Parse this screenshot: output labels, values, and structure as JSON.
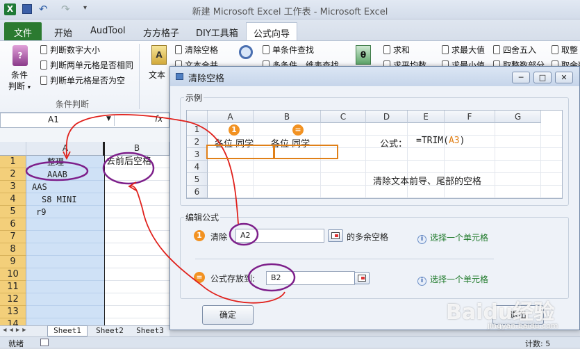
{
  "window": {
    "title": "新建 Microsoft Excel 工作表 - Microsoft Excel",
    "app_icon": "excel-logo"
  },
  "ribbon_tabs": [
    "文件",
    "开始",
    "AudTool",
    "方方格子",
    "DIY工具箱",
    "公式向导"
  ],
  "active_tab_index": 5,
  "ribbon": {
    "big_button_1": {
      "line1": "条件",
      "line2": "判断"
    },
    "cond_items": [
      "判断数字大小",
      "判断两单元格是否相同",
      "判断单元格是否为空"
    ],
    "group_label": "条件判断",
    "big_button_2": "文本",
    "text_items": [
      "清除空格",
      "文本合并"
    ],
    "lookup_items": [
      "单条件查找",
      "多条件、维表查找"
    ],
    "math_items": [
      "求和",
      "求平均数"
    ],
    "stat_items": [
      "求最大值",
      "求最小值"
    ],
    "round_items": [
      "四舍五入",
      "取整数部分"
    ],
    "cut_items": [
      "取整",
      "取余数"
    ]
  },
  "name_box": "A1",
  "formula_fx": "fx",
  "sheet": {
    "columns": [
      "A",
      "B"
    ],
    "rows": [
      "1",
      "2",
      "3",
      "4",
      "5",
      "6",
      "7",
      "8",
      "9",
      "10",
      "11",
      "12",
      "13",
      "14"
    ],
    "col_a": [
      "整理",
      "AAAB",
      "AAS",
      "S8 MINI",
      "r9",
      "",
      "",
      "",
      "",
      "",
      "",
      "",
      "",
      ""
    ],
    "col_b": [
      "去前后空格",
      "",
      "",
      "",
      "",
      "",
      "",
      "",
      "",
      "",
      "",
      "",
      "",
      ""
    ],
    "tabs": [
      "Sheet1",
      "Sheet2",
      "Sheet3"
    ]
  },
  "status": {
    "left": "就绪",
    "count": "计数: 5"
  },
  "dialog": {
    "title": "清除空格",
    "example_label": "示例",
    "example_cols": [
      "A",
      "B",
      "C",
      "D",
      "E",
      "F",
      "G"
    ],
    "example_rows": [
      "1",
      "2",
      "3",
      "4",
      "5",
      "6"
    ],
    "marker_a": "1",
    "marker_b": "=",
    "a3": "各位   同学",
    "b3": "各位  同学",
    "formula_label": "公式：",
    "formula": "=TRIM(A3)",
    "formula_ref": "A3",
    "note": "清除文本前导、尾部的空格",
    "edit_label": "编辑公式",
    "step1_badge": "1",
    "step1_prefix": "清除",
    "step1_value": "A2",
    "step1_suffix": "的多余空格",
    "step1_hint": "选择一个单元格",
    "step2_badge": "=",
    "step2_prefix": "公式存放到:",
    "step2_value": "B2",
    "step2_hint": "选择一个单元格",
    "ok": "确定",
    "exit": "退出"
  },
  "watermark": {
    "main": "Baidu经验",
    "sub": "jingyan.baidu.com"
  },
  "colors": {
    "annotation": "#e0201b",
    "highlight_ellipse": "#7d1f8a",
    "orange": "#e08018",
    "file_tab": "#2b7a30"
  }
}
